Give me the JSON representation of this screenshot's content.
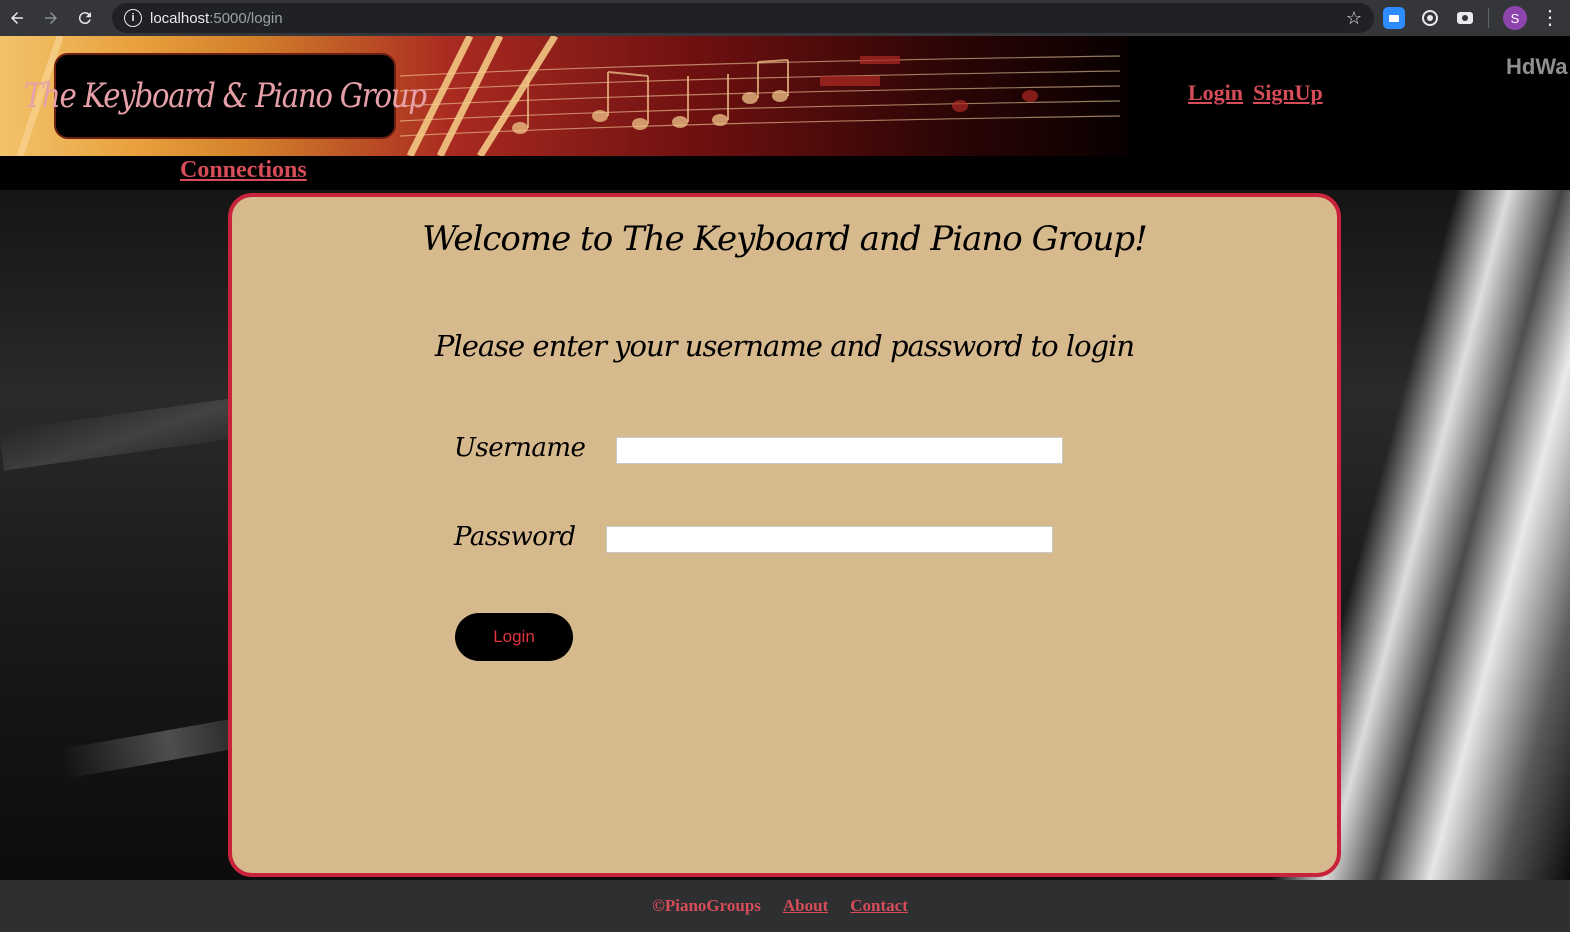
{
  "browser": {
    "url_host": "localhost",
    "url_path": ":5000/login",
    "profile_initial": "S",
    "icons": [
      "back-icon",
      "forward-icon",
      "reload-icon",
      "info-icon",
      "star-icon",
      "zoom-extension-icon",
      "target-extension-icon",
      "camera-extension-icon",
      "more-menu-icon"
    ]
  },
  "header": {
    "logo_text": "The Keyboard & Piano Group",
    "links": [
      "Login",
      "SignUp"
    ],
    "partial_text": "HdWa"
  },
  "nav": {
    "connections": "Connections"
  },
  "main": {
    "welcome": "Welcome to The Keyboard and Piano Group!",
    "prompt": "Please enter your username and password to login",
    "username_label": "Username",
    "username_value": "",
    "password_label": "Password",
    "password_value": "",
    "login_button": "Login"
  },
  "footer": {
    "copyright": "©PianoGroups",
    "about": "About",
    "contact": "Contact"
  },
  "colors": {
    "card_bg": "#d6b98c",
    "card_border": "#c8233a",
    "link": "#d64c59",
    "button_text": "#e0333f"
  }
}
